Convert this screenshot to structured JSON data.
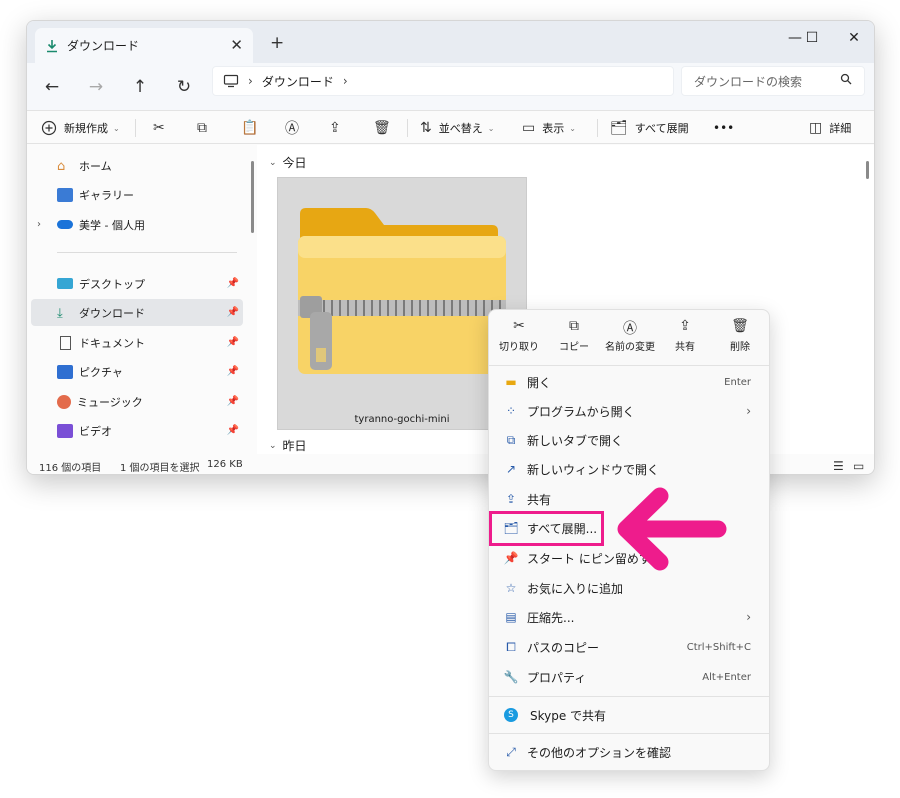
{
  "window": {
    "tab_title": "ダウンロード",
    "close_tab": "✕",
    "new_tab": "+",
    "minimize": "—",
    "maximize": "☐",
    "close": "✕"
  },
  "nav": {
    "back": "←",
    "forward": "→",
    "up": "↑",
    "refresh": "↻"
  },
  "address": {
    "crumb": "ダウンロード",
    "search_placeholder": "ダウンロードの検索"
  },
  "toolbar": {
    "new_label": "新規作成",
    "sort_label": "並べ替え",
    "view_label": "表示",
    "extract_label": "すべて展開",
    "more": "•••",
    "details_label": "詳細"
  },
  "sidebar": {
    "items": [
      {
        "label": "ホーム",
        "icon": "home-icon"
      },
      {
        "label": "ギャラリー",
        "icon": "gallery-icon"
      },
      {
        "label": "美学 - 個人用",
        "icon": "onedrive-icon"
      },
      {
        "label": "デスクトップ",
        "icon": "desktop-icon"
      },
      {
        "label": "ダウンロード",
        "icon": "download-icon"
      },
      {
        "label": "ドキュメント",
        "icon": "document-icon"
      },
      {
        "label": "ピクチャ",
        "icon": "pictures-icon"
      },
      {
        "label": "ミュージック",
        "icon": "music-icon"
      },
      {
        "label": "ビデオ",
        "icon": "video-icon"
      }
    ]
  },
  "content": {
    "group_today": "今日",
    "group_yesterday": "昨日",
    "file_name": "tyranno-gochi-mini"
  },
  "status": {
    "count": "116 個の項目",
    "selected": "1 個の項目を選択",
    "size": "126 KB"
  },
  "context_menu": {
    "actions": [
      "切り取り",
      "コピー",
      "名前の変更",
      "共有",
      "削除"
    ],
    "items": [
      {
        "label": "開く",
        "shortcut": "Enter",
        "icon": "open-icon"
      },
      {
        "label": "プログラムから開く",
        "shortcut": "",
        "icon": "open-with-icon",
        "submenu": true
      },
      {
        "label": "新しいタブで開く",
        "shortcut": "",
        "icon": "new-tab-icon"
      },
      {
        "label": "新しいウィンドウで開く",
        "shortcut": "",
        "icon": "new-window-icon"
      },
      {
        "label": "共有",
        "shortcut": "",
        "icon": "share-icon"
      },
      {
        "label": "すべて展開...",
        "shortcut": "",
        "icon": "extract-icon"
      },
      {
        "label": "スタート にピン留めする",
        "shortcut": "",
        "icon": "pin-icon"
      },
      {
        "label": "お気に入りに追加",
        "shortcut": "",
        "icon": "star-icon"
      },
      {
        "label": "圧縮先...",
        "shortcut": "",
        "icon": "compress-icon",
        "submenu": true
      },
      {
        "label": "パスのコピー",
        "shortcut": "Ctrl+Shift+C",
        "icon": "copy-path-icon"
      },
      {
        "label": "プロパティ",
        "shortcut": "Alt+Enter",
        "icon": "properties-icon"
      },
      {
        "label": "Skype で共有",
        "shortcut": "",
        "icon": "skype-icon"
      },
      {
        "label": "その他のオプションを確認",
        "shortcut": "",
        "icon": "more-options-icon"
      }
    ],
    "submenu_chevron": "›"
  },
  "colors": {
    "highlight": "#ee1c8c",
    "accent": "#0067c0",
    "folder": "#f7c948"
  }
}
